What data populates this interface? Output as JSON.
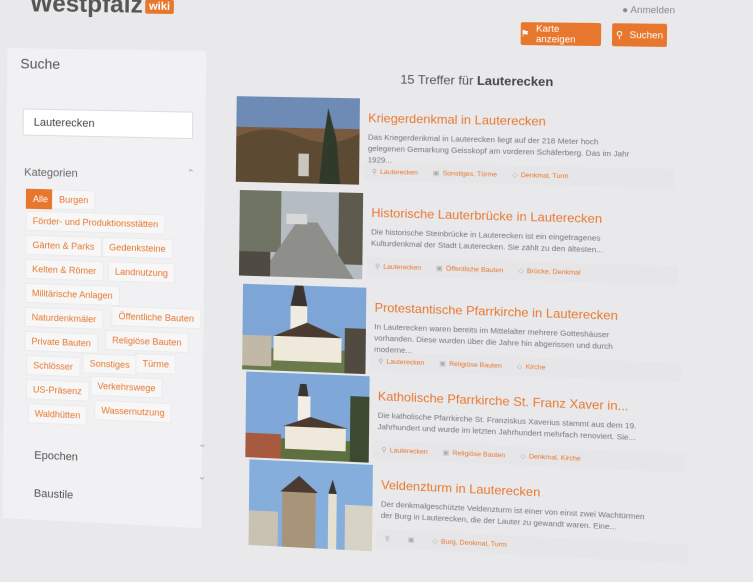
{
  "header": {
    "logo": "Westpfalz",
    "logo_badge": "wiki",
    "user_text": "Anmelden",
    "map_button": "Karte anzeigen",
    "search_button": "Suchen"
  },
  "sidebar": {
    "title": "Suche",
    "search_value": "Lauterecken",
    "categories_title": "Kategorien",
    "tags": [
      "Alle",
      "Burgen",
      "Förder- und Produktionsstätten",
      "Gärten & Parks",
      "Gedenksteine",
      "Kelten & Römer",
      "Landnutzung",
      "Militärische Anlagen",
      "Naturdenkmäler",
      "Öffentliche Bauten",
      "Private Bauten",
      "Religiöse Bauten",
      "Schlösser",
      "Sonstiges",
      "Türme",
      "US-Präsenz",
      "Verkehrswege",
      "Waldhütten",
      "Wassernutzung"
    ],
    "sections": [
      "Epochen",
      "Baustile"
    ]
  },
  "results": {
    "count_text": "15 Treffer für",
    "query": "Lauterecken",
    "items": [
      {
        "title": "Kriegerdenkmal in Lauterecken",
        "desc": "Das Kriegerdenkmal in Lauterecken liegt auf der 218 Meter hoch gelegenen Gemarkung Geisskopf am vorderen Schäferberg. Das im Jahr 1929...",
        "place": "Lauterecken",
        "category": "Sonstiges, Türme",
        "tag": "Denkmal, Turm"
      },
      {
        "title": "Historische Lauterbrücke in Lauterecken",
        "desc": "Die historische Steinbrücke in Lauterecken ist ein eingetragenes Kulturdenkmal der Stadt Lauterecken. Sie zählt zu den ältesten...",
        "place": "Lauterecken",
        "category": "Öffentliche Bauten",
        "tag": "Brücke, Denkmal"
      },
      {
        "title": "Protestantische Pfarrkirche in Lauterecken",
        "desc": "In Lauterecken waren bereits im Mittelalter mehrere Gotteshäuser vorhanden. Diese wurden über die Jahre hin abgerissen und durch moderne...",
        "place": "Lauterecken",
        "category": "Religiöse Bauten",
        "tag": "Kirche"
      },
      {
        "title": "Katholische Pfarrkirche St. Franz Xaver in...",
        "desc": "Die katholische Pfarrkirche St. Franziskus Xaverius stammt aus dem 19. Jahrhundert und wurde im letzten Jahrhundert mehrfach renoviert. Sie...",
        "place": "Lauterecken",
        "category": "Religiöse Bauten",
        "tag": "Denkmal, Kirche"
      },
      {
        "title": "Veldenzturm in Lauterecken",
        "desc": "Der denkmalgeschützte Veldenzturm ist einer von einst zwei Wachtürmen der Burg in Lauterecken, die der Lauter zu gewandt waren. Eine...",
        "place": "",
        "category": "",
        "tag": "Burg, Denkmal, Turm"
      }
    ]
  }
}
